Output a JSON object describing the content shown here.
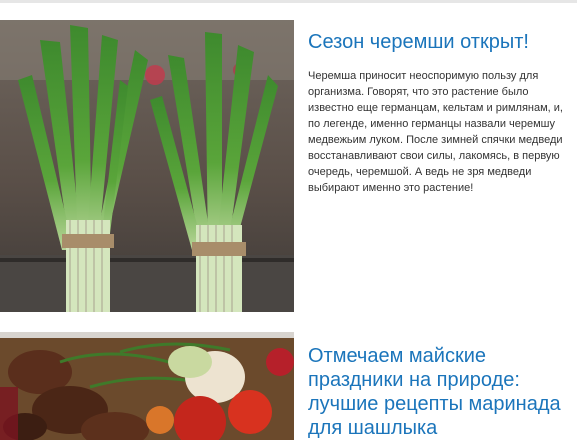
{
  "articles": [
    {
      "title": "Сезон черемши открыт!",
      "excerpt": "Черемша приносит неоспоримую пользу для организма. Говорят, что это растение было известно еще германцам, кельтам и римлянам, и, по легенде, именно германцы назвали черемшу медвежьим луком. После зимней спячки медведи восстанавливают свои силы, лакомясь, в первую очередь, черемшой. А ведь не зря медведи выбирают именно это растение!",
      "image": "wild-garlic-bundles-photo"
    },
    {
      "title": "Отмечаем майские праздники на природе: лучшие рецепты маринада для шашлыка",
      "image": "grilled-meat-vegetables-photo"
    }
  ],
  "colors": {
    "link": "#1b75bb",
    "text": "#333333",
    "divider": "#e3e3e3"
  }
}
